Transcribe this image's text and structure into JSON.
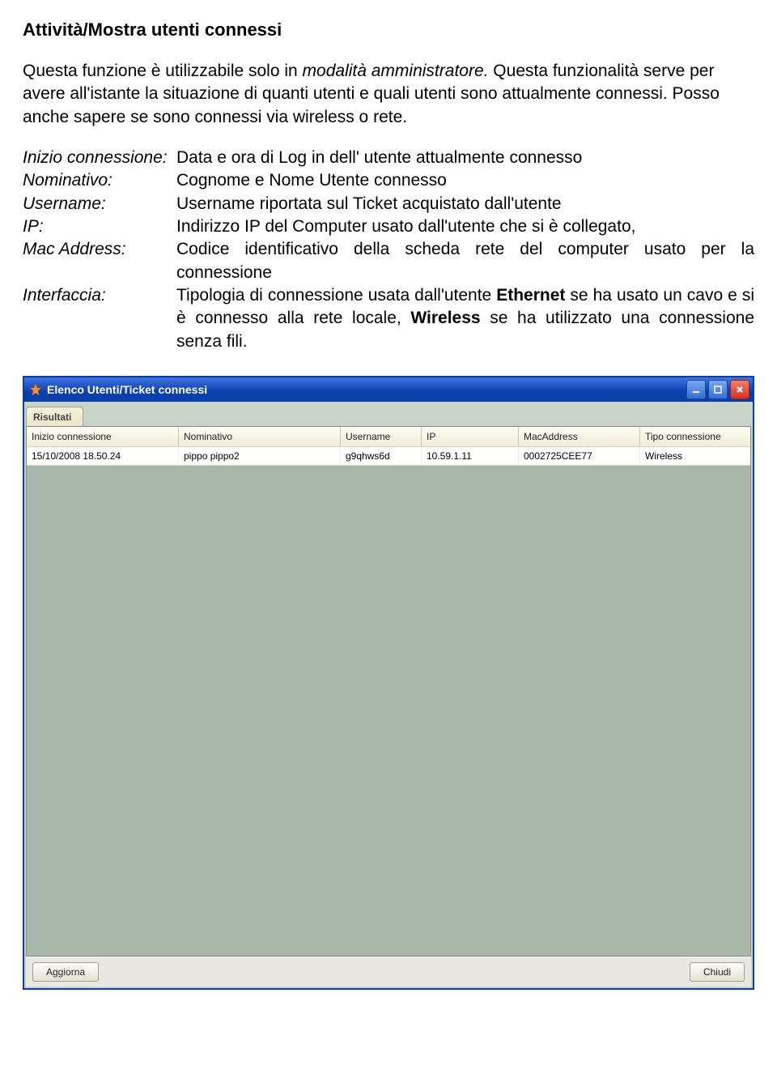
{
  "heading": "Attività/Mostra utenti connessi",
  "intro": {
    "before_italic": "Questa funzione è utilizzabile solo in ",
    "italic": "modalità amministratore.",
    "after_italic": " Questa funzionalità serve per avere all'istante la situazione di quanti utenti e quali utenti sono attualmente connessi. Posso anche sapere se sono connessi via wireless o rete."
  },
  "definitions": [
    {
      "term": "Inizio connessione:",
      "desc": "Data e ora di Log in dell' utente attualmente connesso"
    },
    {
      "term": "Nominativo:",
      "desc": "Cognome e Nome Utente connesso"
    },
    {
      "term": "Username:",
      "desc": "Username riportata sul Ticket acquistato dall'utente"
    },
    {
      "term": "IP:",
      "desc": "Indirizzo IP del Computer usato dall'utente che si è collegato,"
    },
    {
      "term": "Mac Address:",
      "desc": "Codice identificativo della scheda rete del computer usato per la connessione"
    },
    {
      "term": "Interfaccia:",
      "desc_parts": [
        {
          "t": "Tipologia di connessione usata dall'utente "
        },
        {
          "t": "Ethernet",
          "bold": true
        },
        {
          "t": " se ha usato un cavo e si è connesso alla rete locale, "
        },
        {
          "t": "Wireless",
          "bold": true
        },
        {
          "t": " se ha utilizzato una connessione senza fili."
        }
      ]
    }
  ],
  "window": {
    "title": "Elenco Utenti/Ticket connessi",
    "tab_label": "Risultati",
    "columns": [
      "Inizio connessione",
      "Nominativo",
      "Username",
      "IP",
      "MacAddress",
      "Tipo connessione"
    ],
    "rows": [
      [
        "15/10/2008 18.50.24",
        "pippo pippo2",
        "g9qhws6d",
        "10.59.1.11",
        "0002725CEE77",
        "Wireless"
      ]
    ],
    "buttons": {
      "refresh": "Aggiorna",
      "close": "Chiudi"
    }
  }
}
